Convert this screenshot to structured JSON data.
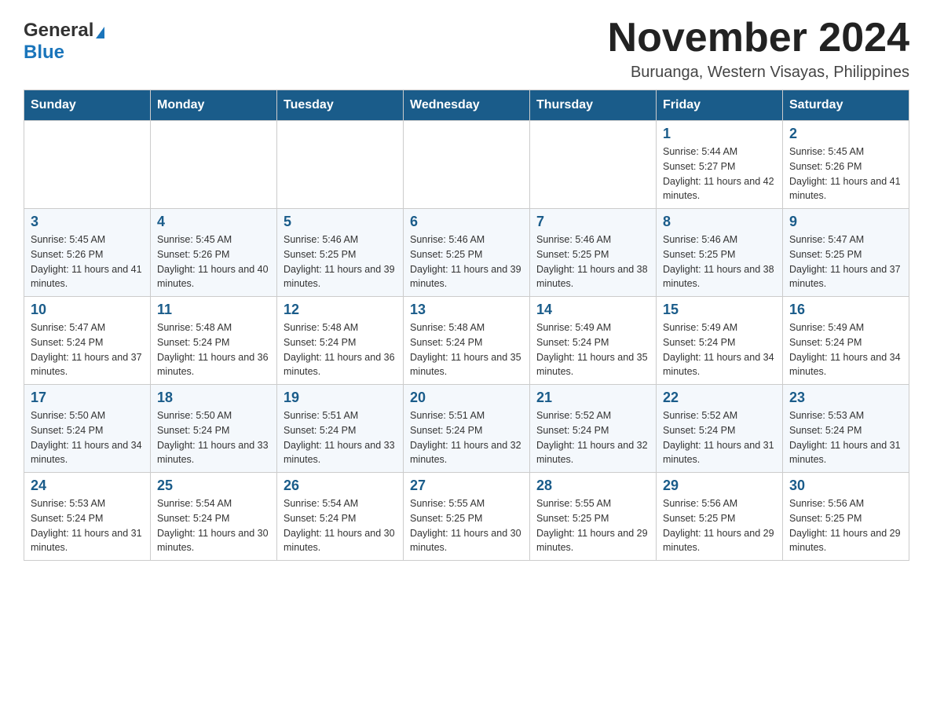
{
  "logo": {
    "general": "General",
    "blue": "Blue"
  },
  "header": {
    "month": "November 2024",
    "location": "Buruanga, Western Visayas, Philippines"
  },
  "weekdays": [
    "Sunday",
    "Monday",
    "Tuesday",
    "Wednesday",
    "Thursday",
    "Friday",
    "Saturday"
  ],
  "weeks": [
    [
      {
        "day": "",
        "info": ""
      },
      {
        "day": "",
        "info": ""
      },
      {
        "day": "",
        "info": ""
      },
      {
        "day": "",
        "info": ""
      },
      {
        "day": "",
        "info": ""
      },
      {
        "day": "1",
        "info": "Sunrise: 5:44 AM\nSunset: 5:27 PM\nDaylight: 11 hours and 42 minutes."
      },
      {
        "day": "2",
        "info": "Sunrise: 5:45 AM\nSunset: 5:26 PM\nDaylight: 11 hours and 41 minutes."
      }
    ],
    [
      {
        "day": "3",
        "info": "Sunrise: 5:45 AM\nSunset: 5:26 PM\nDaylight: 11 hours and 41 minutes."
      },
      {
        "day": "4",
        "info": "Sunrise: 5:45 AM\nSunset: 5:26 PM\nDaylight: 11 hours and 40 minutes."
      },
      {
        "day": "5",
        "info": "Sunrise: 5:46 AM\nSunset: 5:25 PM\nDaylight: 11 hours and 39 minutes."
      },
      {
        "day": "6",
        "info": "Sunrise: 5:46 AM\nSunset: 5:25 PM\nDaylight: 11 hours and 39 minutes."
      },
      {
        "day": "7",
        "info": "Sunrise: 5:46 AM\nSunset: 5:25 PM\nDaylight: 11 hours and 38 minutes."
      },
      {
        "day": "8",
        "info": "Sunrise: 5:46 AM\nSunset: 5:25 PM\nDaylight: 11 hours and 38 minutes."
      },
      {
        "day": "9",
        "info": "Sunrise: 5:47 AM\nSunset: 5:25 PM\nDaylight: 11 hours and 37 minutes."
      }
    ],
    [
      {
        "day": "10",
        "info": "Sunrise: 5:47 AM\nSunset: 5:24 PM\nDaylight: 11 hours and 37 minutes."
      },
      {
        "day": "11",
        "info": "Sunrise: 5:48 AM\nSunset: 5:24 PM\nDaylight: 11 hours and 36 minutes."
      },
      {
        "day": "12",
        "info": "Sunrise: 5:48 AM\nSunset: 5:24 PM\nDaylight: 11 hours and 36 minutes."
      },
      {
        "day": "13",
        "info": "Sunrise: 5:48 AM\nSunset: 5:24 PM\nDaylight: 11 hours and 35 minutes."
      },
      {
        "day": "14",
        "info": "Sunrise: 5:49 AM\nSunset: 5:24 PM\nDaylight: 11 hours and 35 minutes."
      },
      {
        "day": "15",
        "info": "Sunrise: 5:49 AM\nSunset: 5:24 PM\nDaylight: 11 hours and 34 minutes."
      },
      {
        "day": "16",
        "info": "Sunrise: 5:49 AM\nSunset: 5:24 PM\nDaylight: 11 hours and 34 minutes."
      }
    ],
    [
      {
        "day": "17",
        "info": "Sunrise: 5:50 AM\nSunset: 5:24 PM\nDaylight: 11 hours and 34 minutes."
      },
      {
        "day": "18",
        "info": "Sunrise: 5:50 AM\nSunset: 5:24 PM\nDaylight: 11 hours and 33 minutes."
      },
      {
        "day": "19",
        "info": "Sunrise: 5:51 AM\nSunset: 5:24 PM\nDaylight: 11 hours and 33 minutes."
      },
      {
        "day": "20",
        "info": "Sunrise: 5:51 AM\nSunset: 5:24 PM\nDaylight: 11 hours and 32 minutes."
      },
      {
        "day": "21",
        "info": "Sunrise: 5:52 AM\nSunset: 5:24 PM\nDaylight: 11 hours and 32 minutes."
      },
      {
        "day": "22",
        "info": "Sunrise: 5:52 AM\nSunset: 5:24 PM\nDaylight: 11 hours and 31 minutes."
      },
      {
        "day": "23",
        "info": "Sunrise: 5:53 AM\nSunset: 5:24 PM\nDaylight: 11 hours and 31 minutes."
      }
    ],
    [
      {
        "day": "24",
        "info": "Sunrise: 5:53 AM\nSunset: 5:24 PM\nDaylight: 11 hours and 31 minutes."
      },
      {
        "day": "25",
        "info": "Sunrise: 5:54 AM\nSunset: 5:24 PM\nDaylight: 11 hours and 30 minutes."
      },
      {
        "day": "26",
        "info": "Sunrise: 5:54 AM\nSunset: 5:24 PM\nDaylight: 11 hours and 30 minutes."
      },
      {
        "day": "27",
        "info": "Sunrise: 5:55 AM\nSunset: 5:25 PM\nDaylight: 11 hours and 30 minutes."
      },
      {
        "day": "28",
        "info": "Sunrise: 5:55 AM\nSunset: 5:25 PM\nDaylight: 11 hours and 29 minutes."
      },
      {
        "day": "29",
        "info": "Sunrise: 5:56 AM\nSunset: 5:25 PM\nDaylight: 11 hours and 29 minutes."
      },
      {
        "day": "30",
        "info": "Sunrise: 5:56 AM\nSunset: 5:25 PM\nDaylight: 11 hours and 29 minutes."
      }
    ]
  ]
}
